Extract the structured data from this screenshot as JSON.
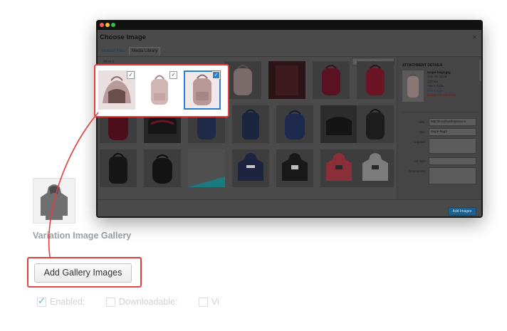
{
  "background": {
    "gallery_title": "Variation Image Gallery",
    "add_button_label": "Add Gallery Images",
    "checkboxes": [
      {
        "label": "Enabled:",
        "checked": true
      },
      {
        "label": "Downloadable:",
        "checked": false
      },
      {
        "label": "Vi",
        "checked": false
      }
    ]
  },
  "modal": {
    "title": "Choose Image",
    "close_glyph": "×",
    "tabs": [
      "Upload Files",
      "Media Library"
    ],
    "filter_label": "All m il",
    "search_placeholder": "Search media items...",
    "attachment": {
      "heading": "ATTACHMENT DETAILS",
      "filename": "taupe-bag3.jpg",
      "date": "July 18, 2018",
      "filesize": "126 KB",
      "dimensions": "750 × 1125",
      "edit_link": "Edit Image",
      "delete_link": "Delete Permanently",
      "fields": [
        {
          "label": "URL",
          "value": "http://localhost/wp/woo-v"
        },
        {
          "label": "Title",
          "value": "taupe-bag3"
        },
        {
          "label": "Caption",
          "value": ""
        },
        {
          "label": "Alt Text",
          "value": ""
        },
        {
          "label": "Description",
          "value": ""
        }
      ],
      "required_note": "Required fields are marked",
      "required_star": "*"
    },
    "add_images_button": "Add Images",
    "check_glyph": "✓"
  },
  "colors": {
    "highlight": "#e13f3f",
    "select_blue": "#2b7fd1",
    "button_blue": "#1f5f8b"
  }
}
